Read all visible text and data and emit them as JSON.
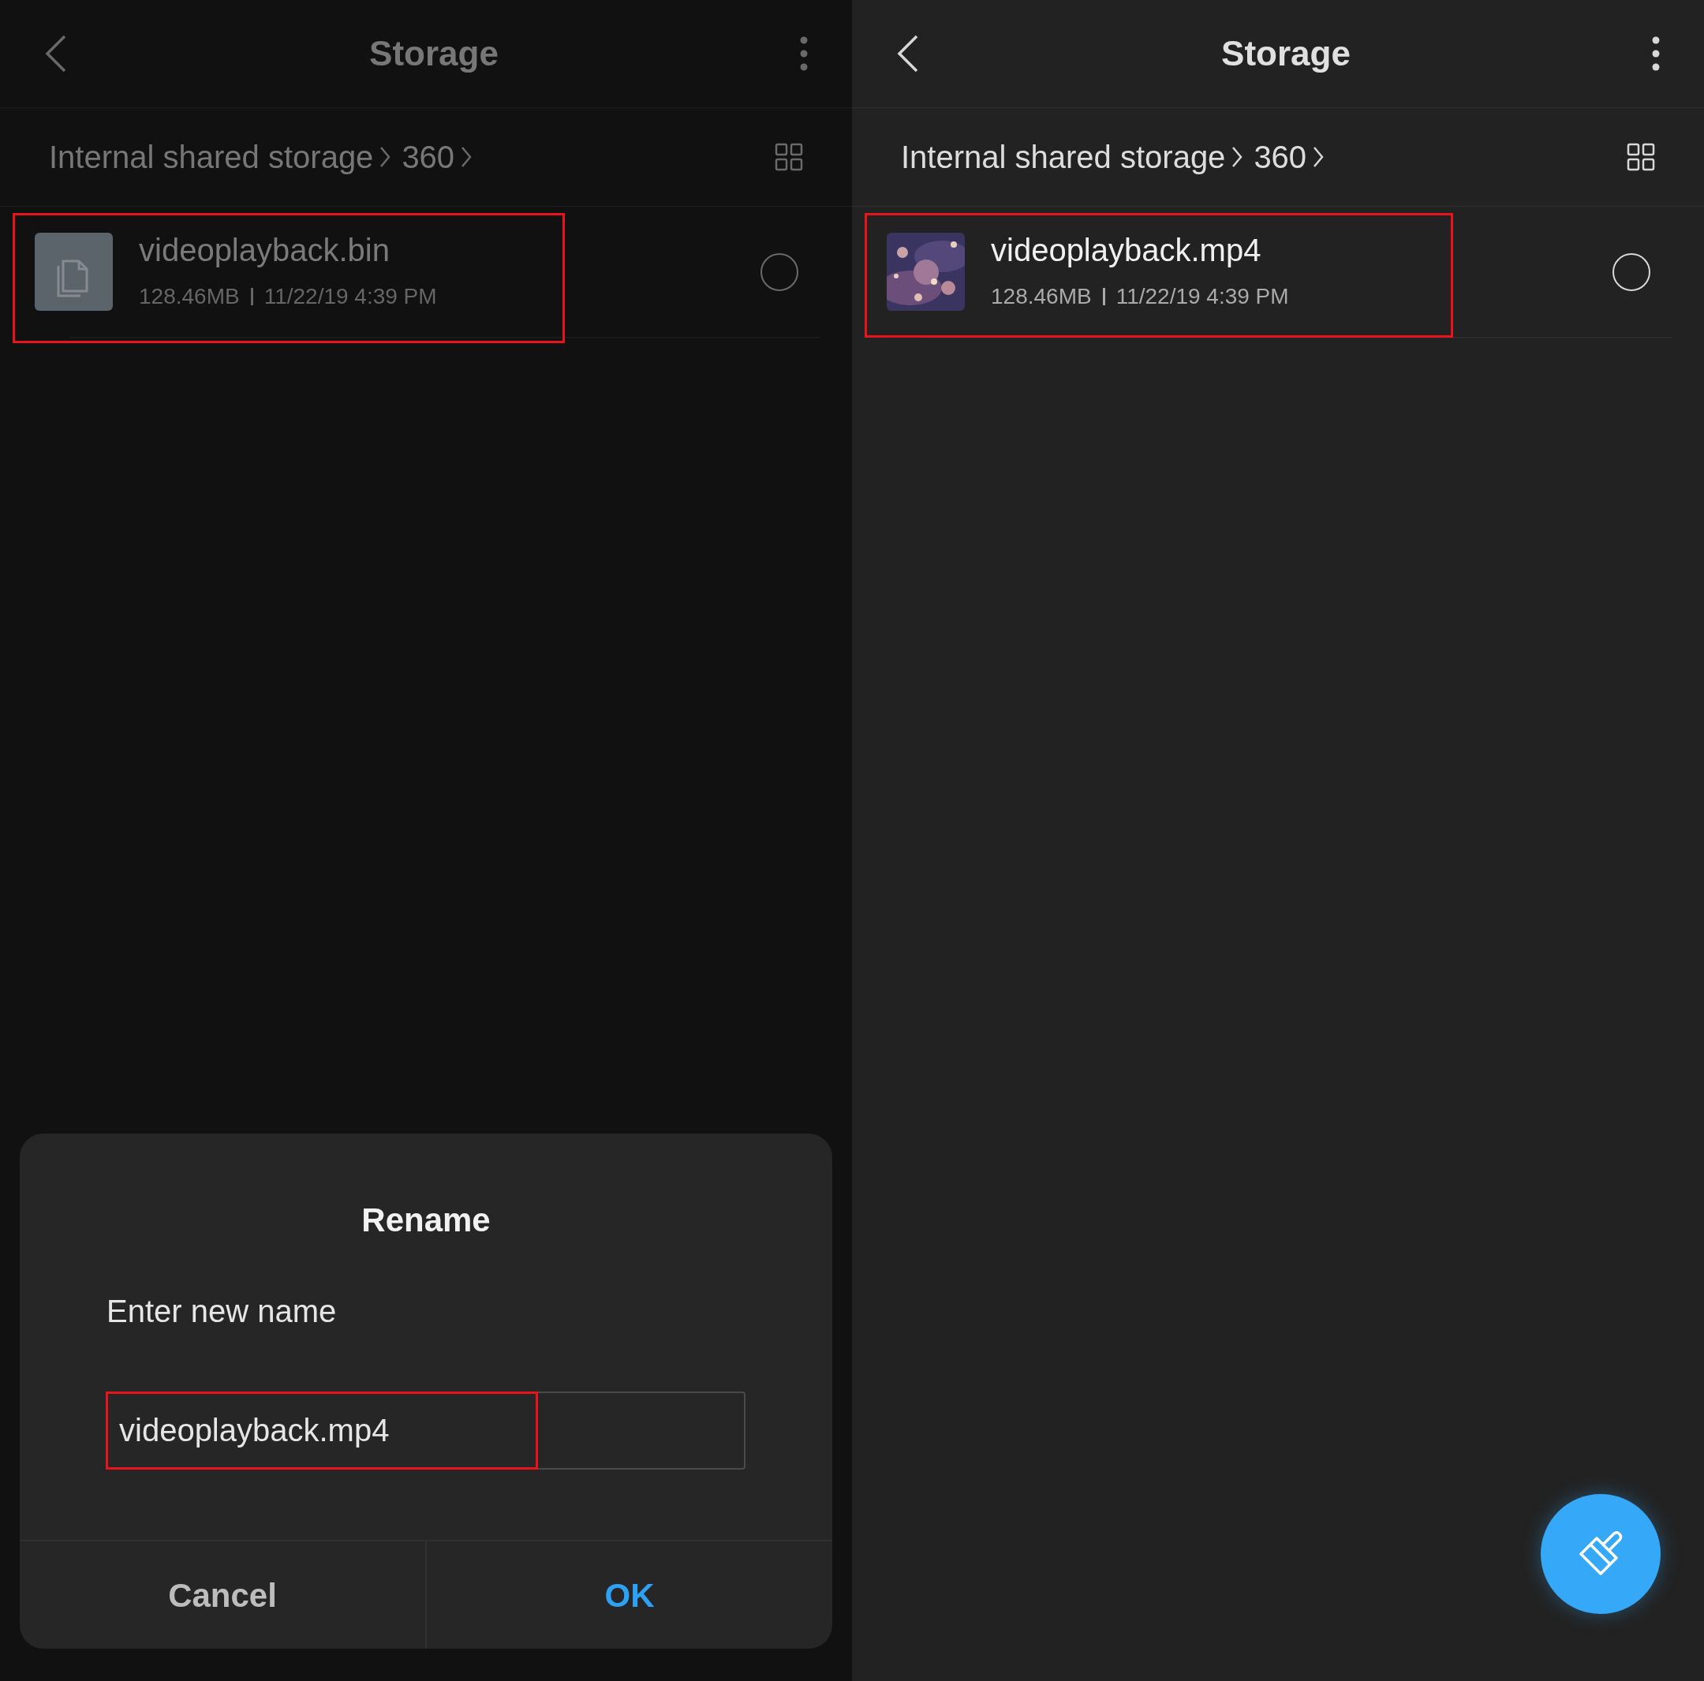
{
  "panels": [
    {
      "dimmed": true,
      "header": {
        "title": "Storage"
      },
      "breadcrumb": [
        "Internal shared storage",
        "360"
      ],
      "files": [
        {
          "kind": "document",
          "name": "videoplayback.bin",
          "size": "128.46MB",
          "date": "11/22/19 4:39 PM",
          "selected": false,
          "highlighted": true
        }
      ],
      "dialog": {
        "title": "Rename",
        "prompt": "Enter new name",
        "value": "videoplayback.mp4",
        "highlighted": true,
        "buttons": [
          {
            "label": "Cancel",
            "kind": "secondary"
          },
          {
            "label": "OK",
            "kind": "primary"
          }
        ]
      }
    },
    {
      "dimmed": false,
      "header": {
        "title": "Storage"
      },
      "breadcrumb": [
        "Internal shared storage",
        "360"
      ],
      "files": [
        {
          "kind": "picture",
          "name": "videoplayback.mp4",
          "size": "128.46MB",
          "date": "11/22/19 4:39 PM",
          "selected": false,
          "highlighted": true
        }
      ],
      "fab": {
        "kind": "clean"
      }
    }
  ]
}
